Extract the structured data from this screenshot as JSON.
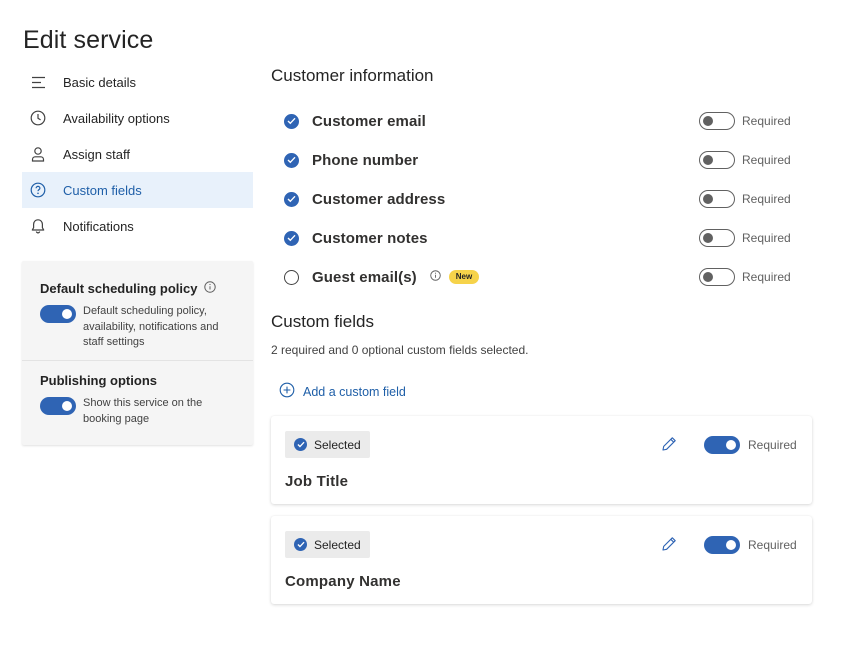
{
  "page": {
    "title": "Edit service"
  },
  "nav": {
    "items": [
      {
        "label": "Basic details",
        "icon": "text-lines-icon"
      },
      {
        "label": "Availability options",
        "icon": "clock-icon"
      },
      {
        "label": "Assign staff",
        "icon": "person-icon"
      },
      {
        "label": "Custom fields",
        "icon": "question-circle-icon",
        "active": true
      },
      {
        "label": "Notifications",
        "icon": "bell-icon"
      }
    ]
  },
  "policy": {
    "default_heading": "Default scheduling policy",
    "default_desc": "Default scheduling policy, availability, notifications and staff settings",
    "default_on": true,
    "publishing_heading": "Publishing options",
    "publishing_desc": "Show this service on the booking page",
    "publishing_on": true
  },
  "customer_info": {
    "title": "Customer information",
    "required_label": "Required",
    "fields": [
      {
        "label": "Customer email",
        "checked": true,
        "required": false
      },
      {
        "label": "Phone number",
        "checked": true,
        "required": false
      },
      {
        "label": "Customer address",
        "checked": true,
        "required": false
      },
      {
        "label": "Customer notes",
        "checked": true,
        "required": false
      },
      {
        "label": "Guest email(s)",
        "checked": false,
        "required": false,
        "badge": "New"
      }
    ]
  },
  "custom_fields": {
    "title": "Custom fields",
    "summary": "2 required and 0 optional custom fields selected.",
    "add_label": "Add a custom field",
    "selected_label": "Selected",
    "required_label": "Required",
    "cards": [
      {
        "name": "Job Title",
        "required": true
      },
      {
        "name": "Company Name",
        "required": true
      }
    ]
  },
  "colors": {
    "accent": "#2f64b4",
    "active_bg": "#e8f1fb",
    "badge": "#f6d34a"
  }
}
